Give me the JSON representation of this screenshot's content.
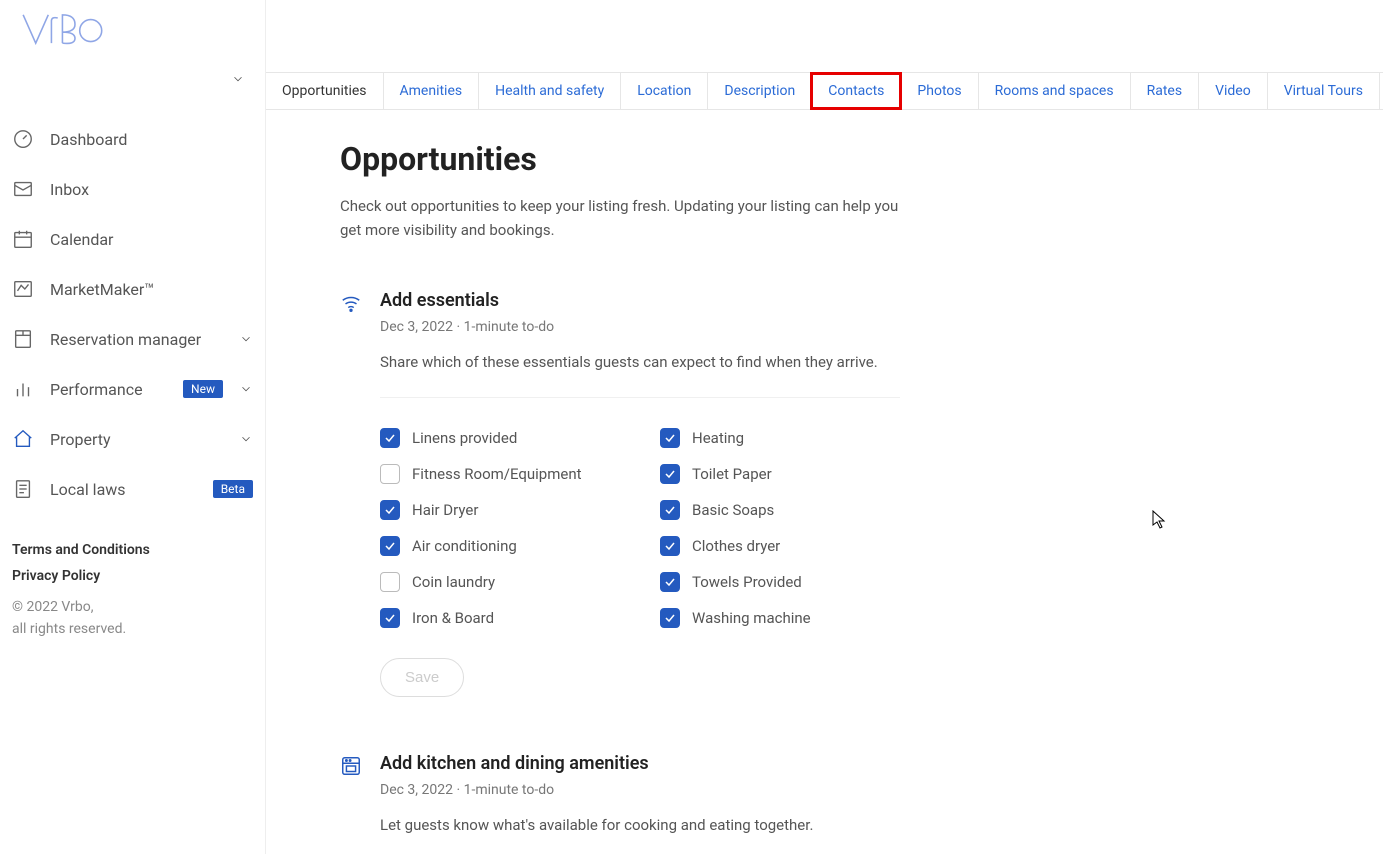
{
  "brand": "Vrbo",
  "sidebar": {
    "items": [
      {
        "label": "Dashboard",
        "icon": "dashboard"
      },
      {
        "label": "Inbox",
        "icon": "inbox"
      },
      {
        "label": "Calendar",
        "icon": "calendar"
      },
      {
        "label": "MarketMaker™",
        "icon": "chart"
      },
      {
        "label": "Reservation manager",
        "icon": "reservation",
        "expandable": true
      },
      {
        "label": "Performance",
        "icon": "bars",
        "expandable": true,
        "badge": "New"
      },
      {
        "label": "Property",
        "icon": "home",
        "expandable": true,
        "active": true
      },
      {
        "label": "Local laws",
        "icon": "doc",
        "badge": "Beta"
      }
    ],
    "footer": {
      "terms": "Terms and Conditions",
      "privacy": "Privacy Policy",
      "copy1": "© 2022 Vrbo,",
      "copy2": "all rights reserved."
    }
  },
  "tabs": [
    "Opportunities",
    "Amenities",
    "Health and safety",
    "Location",
    "Description",
    "Contacts",
    "Photos",
    "Rooms and spaces",
    "Rates",
    "Video",
    "Virtual Tours"
  ],
  "tabs_current": 0,
  "tabs_highlight": 5,
  "page": {
    "title": "Opportunities",
    "lede": "Check out opportunities to keep your listing fresh. Updating your listing can help you get more visibility and bookings."
  },
  "card_essentials": {
    "title": "Add essentials",
    "meta": "Dec 3, 2022 · 1-minute to-do",
    "desc": "Share which of these essentials guests can expect to find when they arrive.",
    "checks": [
      {
        "label": "Linens provided",
        "checked": true
      },
      {
        "label": "Heating",
        "checked": true
      },
      {
        "label": "Fitness Room/Equipment",
        "checked": false
      },
      {
        "label": "Toilet Paper",
        "checked": true
      },
      {
        "label": "Hair Dryer",
        "checked": true
      },
      {
        "label": "Basic Soaps",
        "checked": true
      },
      {
        "label": "Air conditioning",
        "checked": true
      },
      {
        "label": "Clothes dryer",
        "checked": true
      },
      {
        "label": "Coin laundry",
        "checked": false
      },
      {
        "label": "Towels Provided",
        "checked": true
      },
      {
        "label": "Iron & Board",
        "checked": true
      },
      {
        "label": "Washing machine",
        "checked": true
      }
    ],
    "save": "Save"
  },
  "card_kitchen": {
    "title": "Add kitchen and dining amenities",
    "meta": "Dec 3, 2022 · 1-minute to-do",
    "desc": "Let guests know what's available for cooking and eating together."
  }
}
